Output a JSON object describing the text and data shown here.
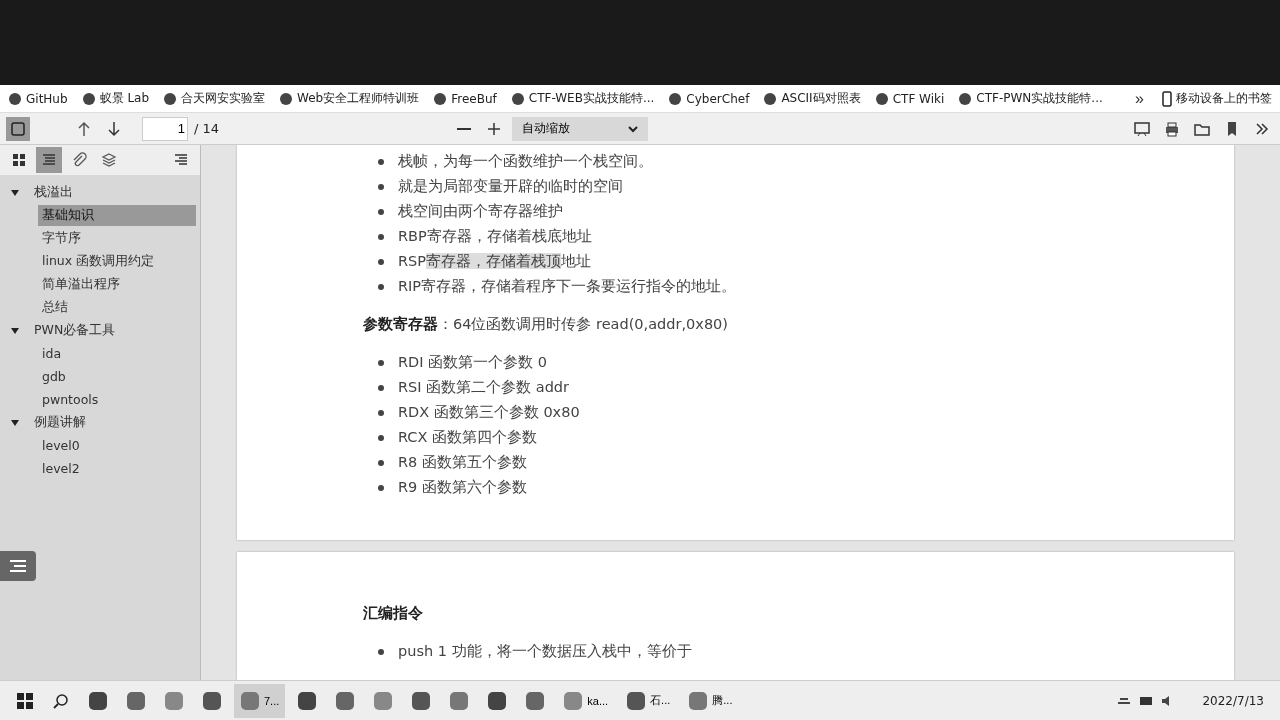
{
  "bookmarks": [
    {
      "label": "GitHub"
    },
    {
      "label": "蚁景 Lab"
    },
    {
      "label": "合天网安实验室"
    },
    {
      "label": "Web安全工程师特训班"
    },
    {
      "label": "FreeBuf"
    },
    {
      "label": "CTF-WEB实战技能特..."
    },
    {
      "label": "CyberChef"
    },
    {
      "label": "ASCII码对照表"
    },
    {
      "label": "CTF Wiki"
    },
    {
      "label": "CTF-PWN实战技能特..."
    }
  ],
  "bookmarks_overflow": "»",
  "mobile_bookmarks": "移动设备上的书签",
  "toolbar": {
    "page": "1",
    "page_count": "/ 14",
    "zoom": "自动缩放"
  },
  "sidebar": {
    "tabs": [
      {
        "kind": "thumbnails",
        "selected": false
      },
      {
        "kind": "outline",
        "selected": true
      },
      {
        "kind": "attachments",
        "selected": false
      },
      {
        "kind": "layers",
        "selected": false
      }
    ],
    "outline": [
      {
        "label": "栈溢出",
        "expanded": true,
        "selected": false,
        "children": [
          {
            "label": "基础知识",
            "selected": true
          },
          {
            "label": "字节序",
            "selected": false
          },
          {
            "label": "linux 函数调用约定",
            "selected": false
          },
          {
            "label": "简单溢出程序",
            "selected": false
          },
          {
            "label": "总结",
            "selected": false
          }
        ]
      },
      {
        "label": "PWN必备工具",
        "expanded": true,
        "selected": false,
        "children": [
          {
            "label": "ida",
            "selected": false
          },
          {
            "label": "gdb",
            "selected": false
          },
          {
            "label": "pwntools",
            "selected": false
          }
        ]
      },
      {
        "label": "例题讲解",
        "expanded": true,
        "selected": false,
        "children": [
          {
            "label": "level0",
            "selected": false
          },
          {
            "label": "level2",
            "selected": false
          }
        ]
      }
    ]
  },
  "pages": [
    {
      "blocks": [
        {
          "kind": "bullets",
          "items": [
            {
              "parts": [
                {
                  "text": "栈帧，为每一个函数维护一个栈空间。",
                  "highlighted": false
                }
              ]
            },
            {
              "parts": [
                {
                  "text": "就是为局部变量开辟的临时的空间",
                  "highlighted": false
                }
              ]
            },
            {
              "parts": [
                {
                  "text": "栈空间由两个寄存器维护",
                  "highlighted": false
                }
              ]
            },
            {
              "parts": [
                {
                  "text": "RBP寄存器，存储着栈底地址",
                  "highlighted": false
                }
              ]
            },
            {
              "parts": [
                {
                  "text": "RSP",
                  "highlighted": false
                },
                {
                  "text": "寄存器，存储着栈顶",
                  "highlighted": true
                },
                {
                  "text": "地址",
                  "highlighted": false
                }
              ]
            },
            {
              "parts": [
                {
                  "text": "RIP寄存器，存储着程序下一条要运行指令的地址。",
                  "highlighted": false
                }
              ]
            }
          ]
        },
        {
          "kind": "paragraph",
          "text": "**参数寄存器**：64位函数调用时传参   read(0,addr,0x80)"
        },
        {
          "kind": "bullets",
          "items": [
            {
              "parts": [
                {
                  "text": "RDI   函数第一个参数  0",
                  "highlighted": false
                }
              ]
            },
            {
              "parts": [
                {
                  "text": "RSI    函数第二个参数   addr",
                  "highlighted": false
                }
              ]
            },
            {
              "parts": [
                {
                  "text": "RDX   函数第三个参数    0x80",
                  "highlighted": false
                }
              ]
            },
            {
              "parts": [
                {
                  "text": "RCX   函数第四个参数",
                  "highlighted": false
                }
              ]
            },
            {
              "parts": [
                {
                  "text": "R8    函数第五个参数",
                  "highlighted": false
                }
              ]
            },
            {
              "parts": [
                {
                  "text": "R9    函数第六个参数",
                  "highlighted": false
                }
              ]
            }
          ]
        }
      ]
    },
    {
      "blocks": [
        {
          "kind": "heading",
          "text": "汇编指令"
        },
        {
          "kind": "bullets",
          "items": [
            {
              "parts": [
                {
                  "text": "push    1   功能，将一个数据压入栈中，等价于",
                  "highlighted": false
                }
              ]
            }
          ]
        }
      ]
    }
  ],
  "taskbar": {
    "apps": [
      {
        "kind": "start",
        "active": false
      },
      {
        "kind": "search",
        "active": false
      },
      {
        "kind": "app",
        "active": false
      },
      {
        "kind": "app",
        "active": false
      },
      {
        "kind": "app",
        "active": false
      },
      {
        "kind": "app",
        "active": false
      },
      {
        "kind": "app",
        "label": "7...",
        "active": true
      },
      {
        "kind": "app",
        "active": false
      },
      {
        "kind": "app",
        "active": false
      },
      {
        "kind": "app",
        "active": false
      },
      {
        "kind": "app",
        "active": false
      },
      {
        "kind": "app",
        "active": false
      },
      {
        "kind": "app",
        "active": false
      },
      {
        "kind": "app",
        "active": false
      },
      {
        "kind": "app",
        "label": "ka...",
        "active": false
      },
      {
        "kind": "app",
        "label": "石...",
        "active": false
      },
      {
        "kind": "app",
        "label": "腾...",
        "active": false
      }
    ],
    "date": "2022/7/13"
  }
}
